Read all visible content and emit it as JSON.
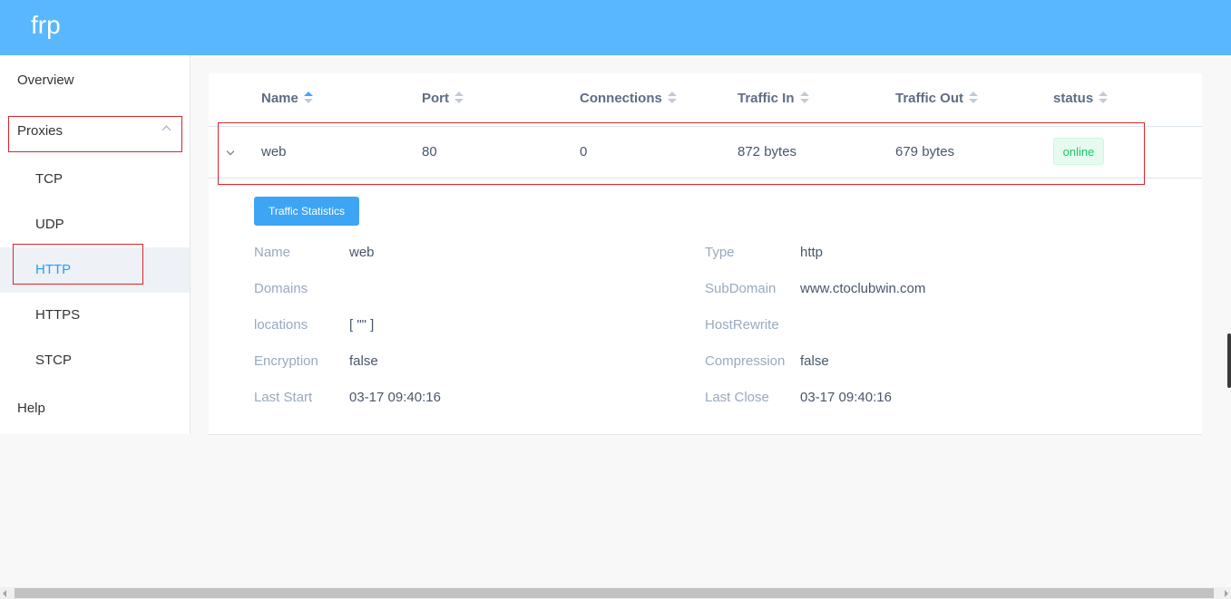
{
  "app": {
    "title": "frp"
  },
  "sidebar": {
    "items": [
      {
        "label": "Overview"
      },
      {
        "label": "Proxies"
      },
      {
        "label": "TCP"
      },
      {
        "label": "UDP"
      },
      {
        "label": "HTTP"
      },
      {
        "label": "HTTPS"
      },
      {
        "label": "STCP"
      },
      {
        "label": "Help"
      }
    ],
    "active": "HTTP"
  },
  "table": {
    "columns": [
      "Name",
      "Port",
      "Connections",
      "Traffic In",
      "Traffic Out",
      "status"
    ],
    "sort": {
      "column": "Name",
      "direction": "ascending"
    },
    "rows": [
      {
        "name": "web",
        "port": "80",
        "connections": "0",
        "traffic_in": "872 bytes",
        "traffic_out": "679 bytes",
        "status": "online"
      }
    ]
  },
  "detail": {
    "button_label": "Traffic Statistics",
    "fields": {
      "name": {
        "label": "Name",
        "value": "web"
      },
      "type": {
        "label": "Type",
        "value": "http"
      },
      "domains": {
        "label": "Domains",
        "value": ""
      },
      "subdomain": {
        "label": "SubDomain",
        "value": "www.ctoclubwin.com"
      },
      "locations": {
        "label": "locations",
        "value": "[ \"\" ]"
      },
      "hostrewrite": {
        "label": "HostRewrite",
        "value": ""
      },
      "encryption": {
        "label": "Encryption",
        "value": "false"
      },
      "compression": {
        "label": "Compression",
        "value": "false"
      },
      "last_start": {
        "label": "Last Start",
        "value": "03-17 09:40:16"
      },
      "last_close": {
        "label": "Last Close",
        "value": "03-17 09:40:16"
      }
    }
  },
  "colors": {
    "header": "#58b7ff",
    "primary": "#20a0ff",
    "online_text": "#13ce66",
    "highlight_box": "#d9262c"
  },
  "icons": [
    "chevron-up-icon",
    "expand-chevron-icon",
    "sort-caret-icon"
  ]
}
